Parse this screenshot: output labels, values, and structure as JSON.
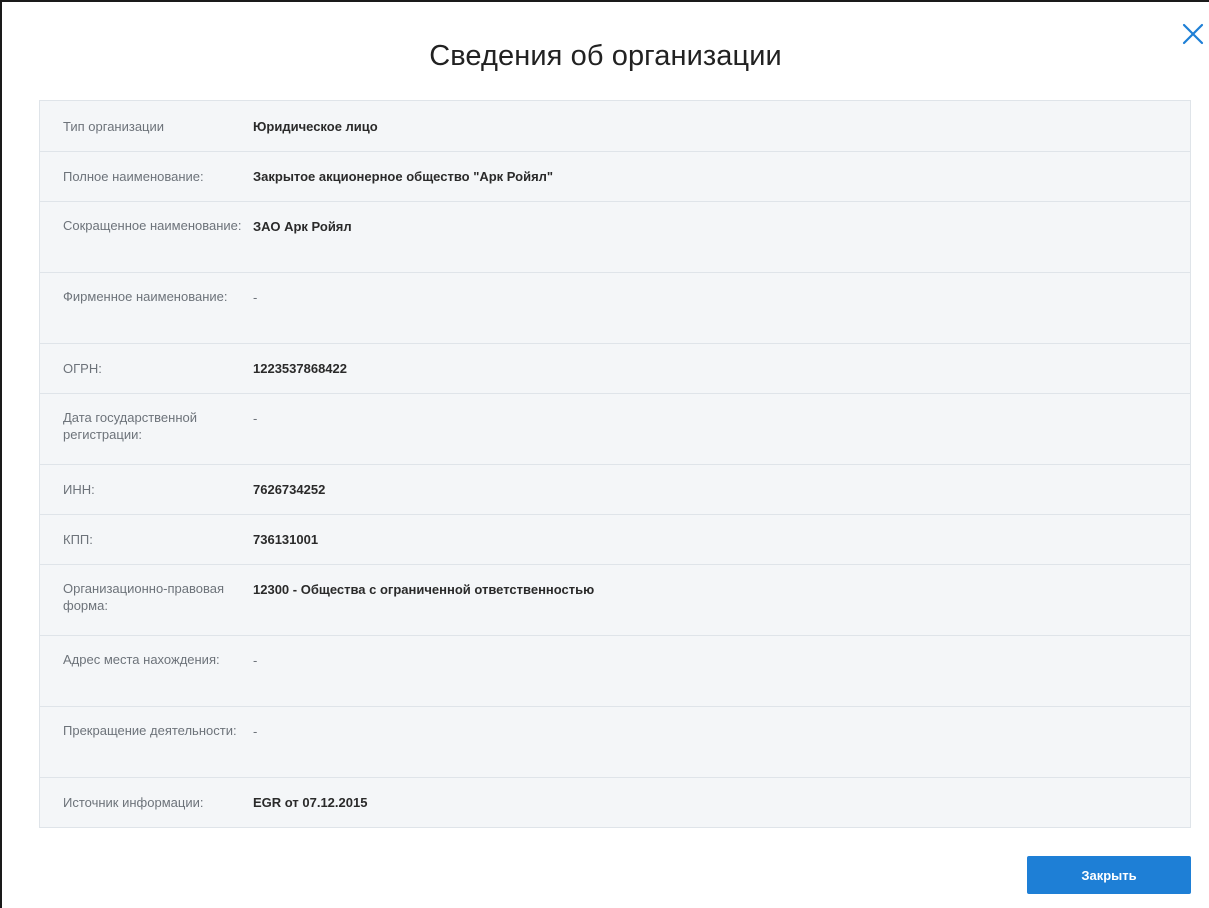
{
  "dialog": {
    "title": "Сведения об организации",
    "close_button_label": "Закрыть",
    "close_icon": "close-icon",
    "accent_color": "#1e7fd6"
  },
  "rows": [
    {
      "label": "Тип организации",
      "value": "Юридическое лицо"
    },
    {
      "label": "Полное наименование:",
      "value": "Закрытое акционерное общество \"Арк Ройял\""
    },
    {
      "label": "Сокращенное наименование:",
      "value": "ЗАО Арк Ройял"
    },
    {
      "label": "Фирменное наименование:",
      "value": "-"
    },
    {
      "label": "ОГРН:",
      "value": "1223537868422"
    },
    {
      "label": "Дата государственной регистрации:",
      "value": "-"
    },
    {
      "label": "ИНН:",
      "value": "7626734252"
    },
    {
      "label": "КПП:",
      "value": "736131001"
    },
    {
      "label": "Организационно-правовая форма:",
      "value": "12300 - Общества с ограниченной ответственностью"
    },
    {
      "label": "Адрес места нахождения:",
      "value": "-"
    },
    {
      "label": "Прекращение деятельности:",
      "value": "-"
    },
    {
      "label": "Источник информации:",
      "value": "EGR от 07.12.2015"
    }
  ]
}
